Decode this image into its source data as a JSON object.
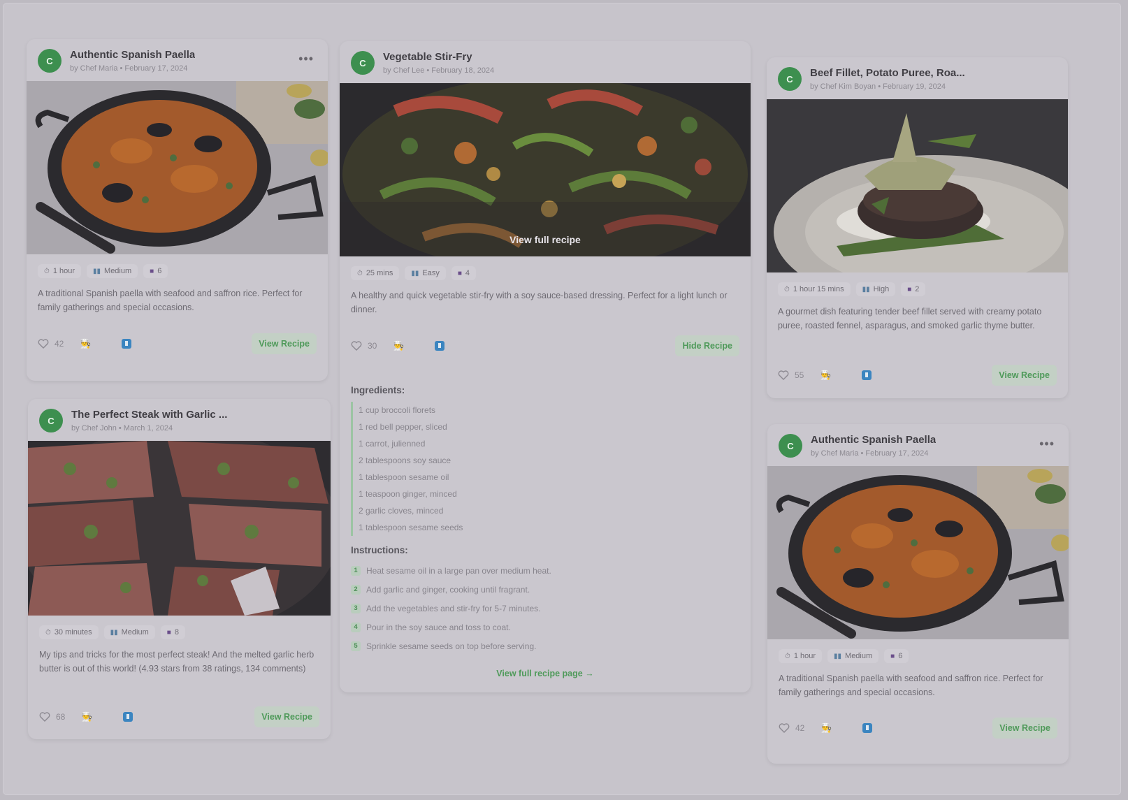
{
  "accent": "#3d8f4f",
  "cards": {
    "paella1": {
      "avatar": "C",
      "title": "Authentic Spanish Paella",
      "byline": "by Chef Maria • February 17, 2024",
      "more": "•••",
      "tags": [
        "1 hour",
        "Medium",
        "6"
      ],
      "description": "A traditional Spanish paella with seafood and saffron rice. Perfect for family gatherings and special occasions.",
      "likes": "42",
      "button": "View Recipe"
    },
    "steak": {
      "avatar": "C",
      "title": "The Perfect Steak with Garlic ...",
      "byline": "by Chef John • March 1, 2024",
      "tags": [
        "30 minutes",
        "Medium",
        "8"
      ],
      "description": "My tips and tricks for the most perfect steak! And the melted garlic herb butter is out of this world! (4.93 stars from 38 ratings, 134 comments)",
      "likes": "68",
      "button": "View Recipe"
    },
    "stirfry": {
      "avatar": "C",
      "title": "Vegetable Stir-Fry",
      "byline": "by Chef Lee • February 18, 2024",
      "overlay": "View full recipe",
      "tags": [
        "25 mins",
        "Easy",
        "4"
      ],
      "description": "A healthy and quick vegetable stir-fry with a soy sauce-based dressing. Perfect for a light lunch or dinner.",
      "likes": "30",
      "button": "Hide Recipe",
      "ingredients_label": "Ingredients:",
      "ingredients": [
        "1 cup broccoli florets",
        "1 red bell pepper, sliced",
        "1 carrot, julienned",
        "2 tablespoons soy sauce",
        "1 tablespoon sesame oil",
        "1 teaspoon ginger, minced",
        "2 garlic cloves, minced",
        "1 tablespoon sesame seeds"
      ],
      "instructions_label": "Instructions:",
      "instructions": [
        {
          "n": "1",
          "text": "Heat sesame oil in a large pan over medium heat."
        },
        {
          "n": "2",
          "text": "Add garlic and ginger, cooking until fragrant."
        },
        {
          "n": "3",
          "text": "Add the vegetables and stir-fry for 5-7 minutes."
        },
        {
          "n": "4",
          "text": "Pour in the soy sauce and toss to coat."
        },
        {
          "n": "5",
          "text": "Sprinkle sesame seeds on top before serving."
        }
      ],
      "full_link": "View full recipe page →"
    },
    "beef": {
      "avatar": "C",
      "title": "Beef Fillet, Potato Puree, Roa...",
      "byline": "by Chef Kim Boyan • February 19, 2024",
      "tags": [
        "1 hour 15 mins",
        "High",
        "2"
      ],
      "description": "A gourmet dish featuring tender beef fillet served with creamy potato puree, roasted fennel, asparagus, and smoked garlic thyme butter.",
      "likes": "55",
      "button": "View Recipe"
    },
    "paella2": {
      "avatar": "C",
      "title": "Authentic Spanish Paella",
      "byline": "by Chef Maria • February 17, 2024",
      "more": "•••",
      "tags": [
        "1 hour",
        "Medium",
        "6"
      ],
      "description": "A traditional Spanish paella with seafood and saffron rice. Perfect for family gatherings and special occasions.",
      "likes": "42",
      "button": "View Recipe"
    }
  }
}
